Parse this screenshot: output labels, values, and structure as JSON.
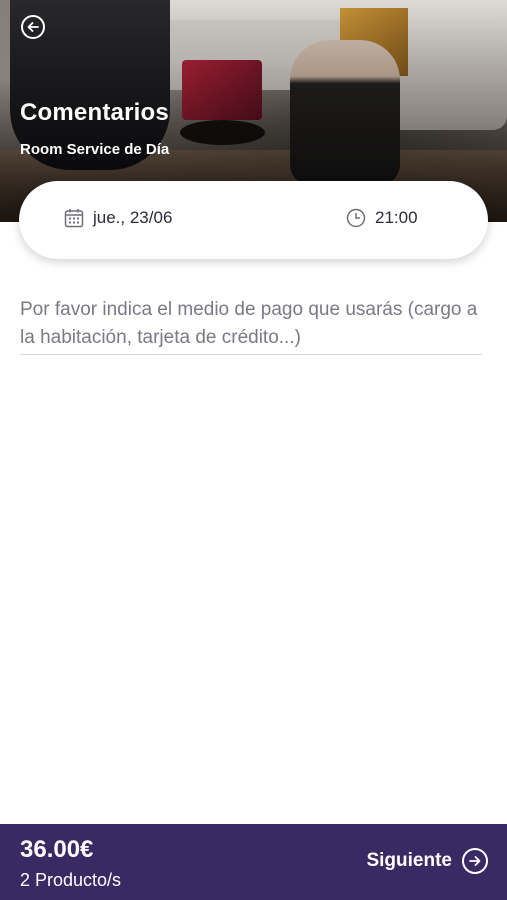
{
  "header": {
    "title": "Comentarios",
    "subtitle": "Room Service de Día",
    "back_icon": "arrow-left-circle-icon"
  },
  "schedule": {
    "date": "jue., 23/06",
    "date_icon": "calendar-icon",
    "time": "21:00",
    "time_icon": "clock-icon"
  },
  "comments": {
    "value": "",
    "placeholder": "Por favor indica el medio de pago que usarás (cargo a la habitación, tarjeta de crédito...)"
  },
  "footer": {
    "total": "36.00€",
    "items_count": "2 Producto/s",
    "next_label": "Siguiente",
    "next_icon": "arrow-right-circle-icon"
  },
  "colors": {
    "primary": "#3a2a63",
    "text_dark": "#2b2b3a",
    "placeholder": "#7a7a86",
    "icon_gray": "#6f6f78"
  }
}
